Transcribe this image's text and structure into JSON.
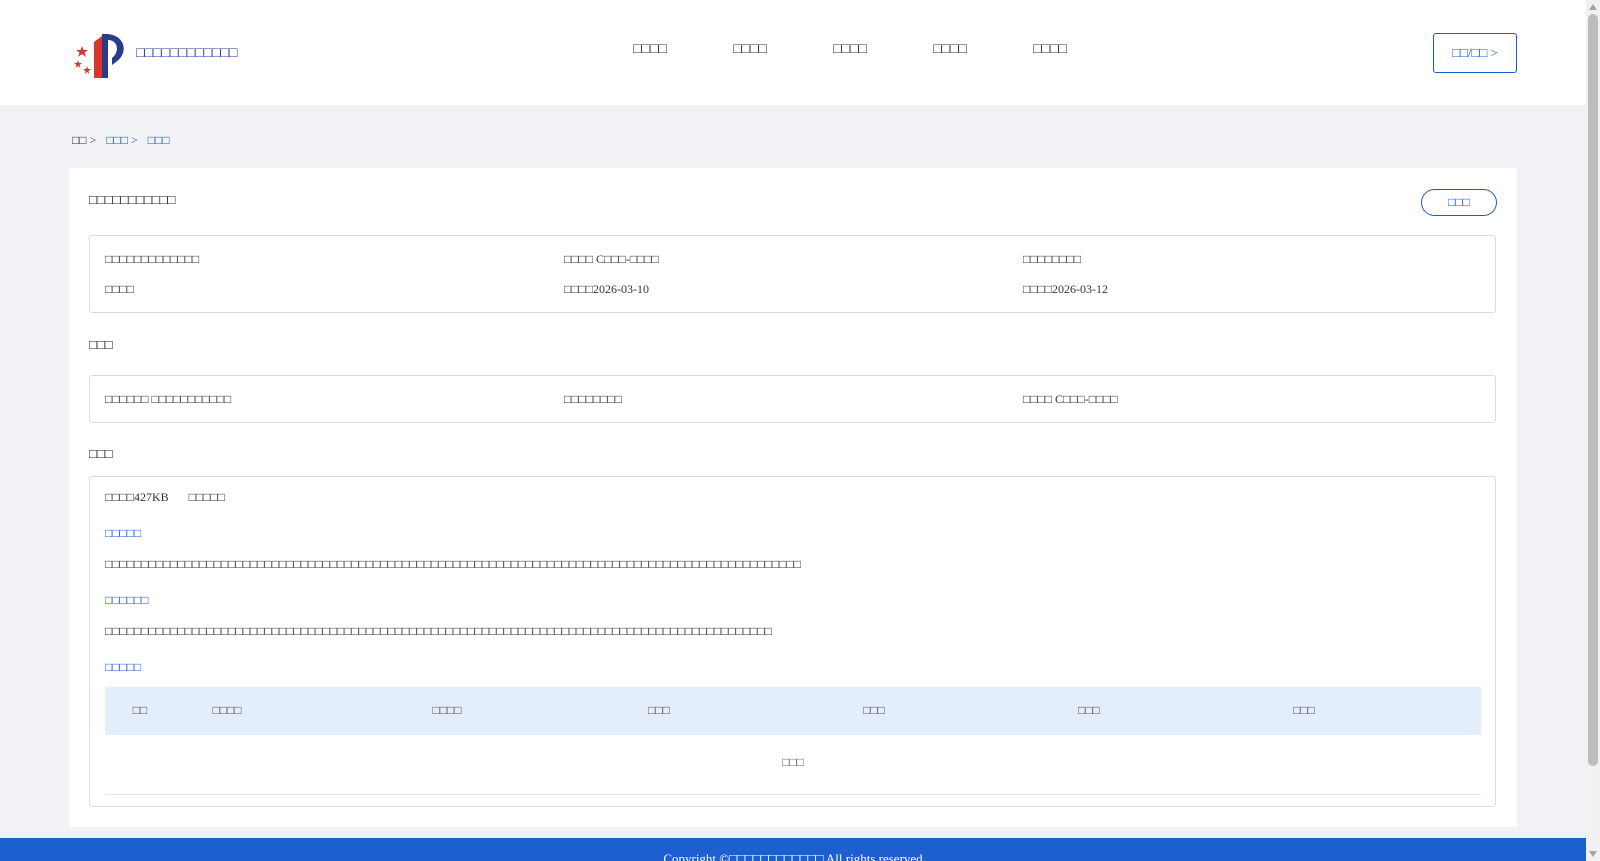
{
  "header": {
    "site_name": "□□□□□□□□□□□□",
    "nav": [
      "□□□□",
      "□□□□",
      "□□□□",
      "□□□□",
      "□□□□"
    ],
    "login_label": "□□/□□ >"
  },
  "breadcrumb": [
    "□□ >",
    "□□□ >",
    "□□□"
  ],
  "panel": {
    "title": "□□□□□□□□□□□",
    "top_button": "□□□",
    "info": {
      "r1c1": "□□□□□□□□□□□□□",
      "r1c2": "□□□□ C□□□-□□□□",
      "r1c3": "□□□□□□□□",
      "r2c1": "□□□□",
      "r2c2": "□□□□2026-03-10",
      "r2c3": "□□□□2026-03-12"
    },
    "section2_title": "□□□",
    "info2": {
      "c1": "□□□□□□ □□□□□□□□□□□",
      "c2": "□□□□□□□□",
      "c3": "□□□□ C□□□-□□□□"
    },
    "section3_title": "□□□",
    "detail": {
      "size": "□□□□427KB",
      "type": "□□□□□",
      "sub1": "□□□□□",
      "para1": "□□□□□□□□□□□□□□□□□□□□□□□□□□□□□□□□□□□□□□□□□□□□□□□□□□□□□□□□□□□□□□□□□□□□□□□□□□□□□□□□□□□□□□□□□□□□□□□□",
      "sub2": "□□□□□□",
      "para2": "□□□□□□□□□□□□□□□□□□□□□□□□□□□□□□□□□□□□□□□□□□□□□□□□□□□□□□□□□□□□□□□□□□□□□□□□□□□□□□□□□□□□□□□□□□□□",
      "sub3": "□□□□□",
      "table_headers": [
        "□□",
        "□□□□",
        "□□□□",
        "□□□",
        "□□□",
        "□□□",
        "□□□"
      ],
      "empty_text": "□□□"
    }
  },
  "footer": {
    "text": "Copyright ©□□□□□□□□□□□□ All rights reserved"
  },
  "colors": {
    "brand": "#1e5bcc",
    "footer": "#1e5fd0",
    "table_header": "#e3edfb"
  }
}
